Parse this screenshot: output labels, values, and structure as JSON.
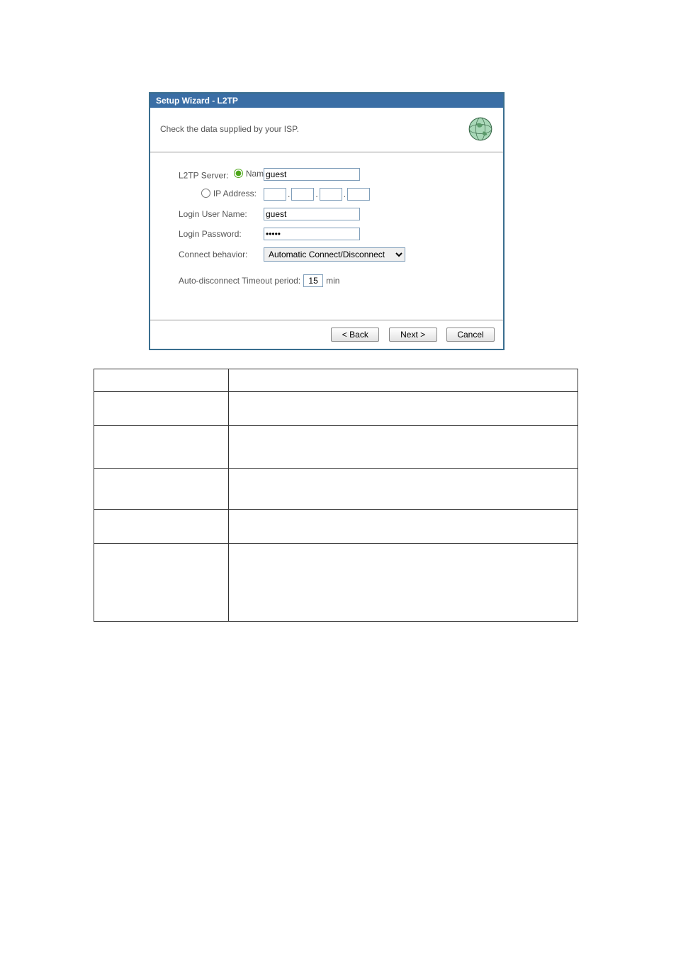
{
  "title": "Setup Wizard - L2TP",
  "instruction": "Check the data supplied by your ISP.",
  "labels": {
    "l2tp_server": "L2TP Server:",
    "name": "Name:",
    "ip_address": "IP Address:",
    "login_user": "Login User Name:",
    "login_pass": "Login Password:",
    "connect_behavior": "Connect behavior:",
    "timeout_prefix": "Auto-disconnect Timeout period:",
    "timeout_unit": "min"
  },
  "values": {
    "server_name": "guest",
    "login_user": "guest",
    "login_pass": "•••••",
    "connect_option": "Automatic Connect/Disconnect",
    "timeout": "15",
    "ip": [
      "",
      "",
      "",
      ""
    ]
  },
  "buttons": {
    "back": "< Back",
    "next": "Next >",
    "cancel": "Cancel"
  }
}
